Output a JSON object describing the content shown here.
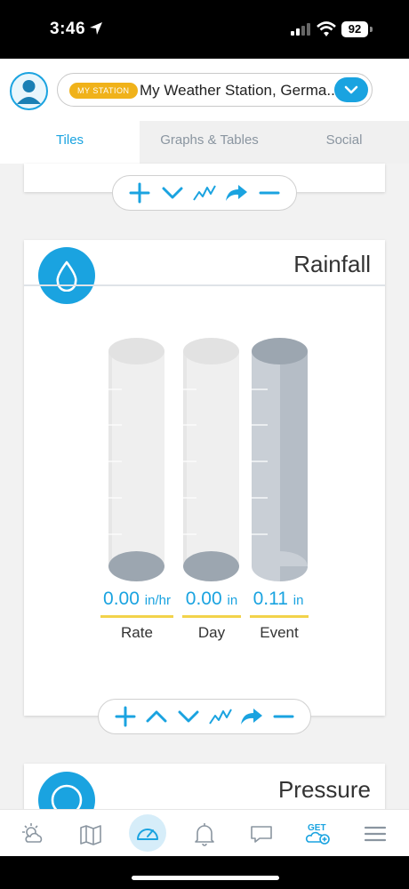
{
  "status_bar": {
    "time": "3:46",
    "battery": "92"
  },
  "header": {
    "station_badge": "MY STATION",
    "station_name": "My Weather Station, Germa..."
  },
  "tabs": [
    {
      "label": "Tiles",
      "active": true
    },
    {
      "label": "Graphs & Tables",
      "active": false
    },
    {
      "label": "Social",
      "active": false
    }
  ],
  "rainfall": {
    "title": "Rainfall",
    "gauges": [
      {
        "value": "0.00",
        "unit": "in/hr",
        "label": "Rate",
        "filled": false
      },
      {
        "value": "0.00",
        "unit": "in",
        "label": "Day",
        "filled": false
      },
      {
        "value": "0.11",
        "unit": "in",
        "label": "Event",
        "filled": true
      }
    ]
  },
  "pressure": {
    "title": "Pressure"
  },
  "bottom_nav": [
    {
      "name": "nav-forecast",
      "icon": "sun-cloud-icon",
      "active": false
    },
    {
      "name": "nav-map",
      "icon": "map-icon",
      "active": false
    },
    {
      "name": "nav-dashboard",
      "icon": "gauge-icon",
      "active": true
    },
    {
      "name": "nav-alerts",
      "icon": "bell-icon",
      "active": false
    },
    {
      "name": "nav-messages",
      "icon": "chat-icon",
      "active": false
    },
    {
      "name": "nav-get",
      "icon": "get-station-icon",
      "label": "GET",
      "active": false
    },
    {
      "name": "nav-menu",
      "icon": "menu-icon",
      "active": false
    }
  ],
  "colors": {
    "accent": "#1aa3e0",
    "badge": "#f0b21a",
    "value_bar": "#f2d34a"
  }
}
